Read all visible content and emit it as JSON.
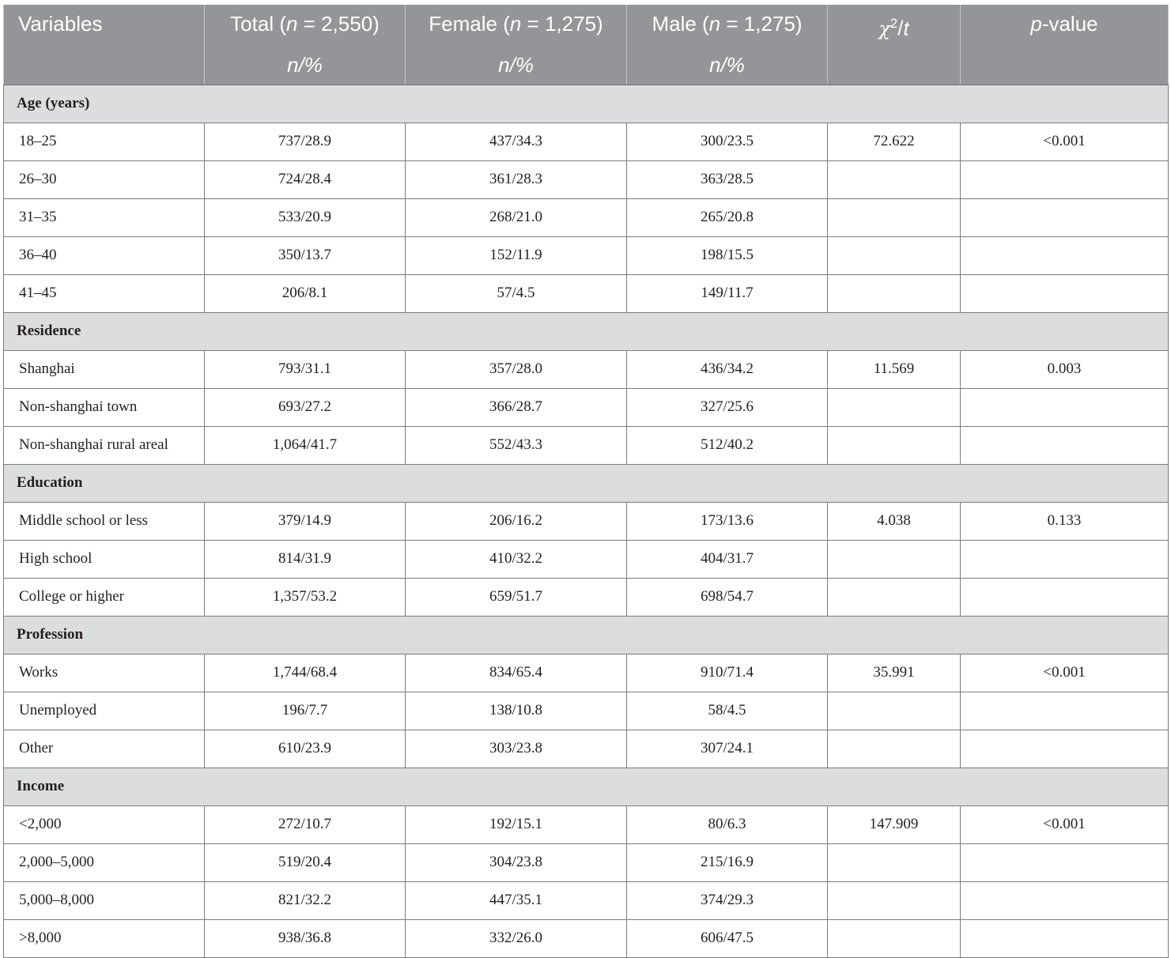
{
  "header": {
    "variables": "Variables",
    "total_label": "Total (",
    "total_n": "n",
    "total_eq": " = 2,550)",
    "female_label": "Female (",
    "female_n": "n",
    "female_eq": " = 1,275)",
    "male_label": "Male (",
    "male_n": "n",
    "male_eq": " = 1,275)",
    "chi_symbol": "χ",
    "chi_sup": "2",
    "chi_rest": "/",
    "chi_t": "t",
    "p_italic": "p",
    "p_rest": "-value",
    "sub_n": "n",
    "sub_pct": "/%"
  },
  "sections": [
    {
      "title": "Age (years)",
      "rows": [
        {
          "label": "18–25",
          "total": "737/28.9",
          "female": "437/34.3",
          "male": "300/23.5",
          "chi": "72.622",
          "p": "<0.001"
        },
        {
          "label": "26–30",
          "total": "724/28.4",
          "female": "361/28.3",
          "male": "363/28.5",
          "chi": "",
          "p": ""
        },
        {
          "label": "31–35",
          "total": "533/20.9",
          "female": "268/21.0",
          "male": "265/20.8",
          "chi": "",
          "p": ""
        },
        {
          "label": "36–40",
          "total": "350/13.7",
          "female": "152/11.9",
          "male": "198/15.5",
          "chi": "",
          "p": ""
        },
        {
          "label": "41–45",
          "total": "206/8.1",
          "female": "57/4.5",
          "male": "149/11.7",
          "chi": "",
          "p": ""
        }
      ]
    },
    {
      "title": "Residence",
      "rows": [
        {
          "label": "Shanghai",
          "total": "793/31.1",
          "female": "357/28.0",
          "male": "436/34.2",
          "chi": "11.569",
          "p": "0.003"
        },
        {
          "label": "Non-shanghai town",
          "total": "693/27.2",
          "female": "366/28.7",
          "male": "327/25.6",
          "chi": "",
          "p": ""
        },
        {
          "label": "Non-shanghai rural areal",
          "total": "1,064/41.7",
          "female": "552/43.3",
          "male": "512/40.2",
          "chi": "",
          "p": ""
        }
      ]
    },
    {
      "title": "Education",
      "rows": [
        {
          "label": "Middle school or less",
          "total": "379/14.9",
          "female": "206/16.2",
          "male": "173/13.6",
          "chi": "4.038",
          "p": "0.133"
        },
        {
          "label": "High school",
          "total": "814/31.9",
          "female": "410/32.2",
          "male": "404/31.7",
          "chi": "",
          "p": ""
        },
        {
          "label": "College or higher",
          "total": "1,357/53.2",
          "female": "659/51.7",
          "male": "698/54.7",
          "chi": "",
          "p": ""
        }
      ]
    },
    {
      "title": "Profession",
      "rows": [
        {
          "label": "Works",
          "total": "1,744/68.4",
          "female": "834/65.4",
          "male": "910/71.4",
          "chi": "35.991",
          "p": "<0.001"
        },
        {
          "label": "Unemployed",
          "total": "196/7.7",
          "female": "138/10.8",
          "male": "58/4.5",
          "chi": "",
          "p": ""
        },
        {
          "label": "Other",
          "total": "610/23.9",
          "female": "303/23.8",
          "male": "307/24.1",
          "chi": "",
          "p": ""
        }
      ]
    },
    {
      "title": "Income",
      "rows": [
        {
          "label": "<2,000",
          "total": "272/10.7",
          "female": "192/15.1",
          "male": "80/6.3",
          "chi": "147.909",
          "p": "<0.001"
        },
        {
          "label": "2,000–5,000",
          "total": "519/20.4",
          "female": "304/23.8",
          "male": "215/16.9",
          "chi": "",
          "p": ""
        },
        {
          "label": "5,000–8,000",
          "total": "821/32.2",
          "female": "447/35.1",
          "male": "374/29.3",
          "chi": "",
          "p": ""
        },
        {
          "label": ">8,000",
          "total": "938/36.8",
          "female": "332/26.0",
          "male": "606/47.5",
          "chi": "",
          "p": ""
        }
      ]
    }
  ]
}
